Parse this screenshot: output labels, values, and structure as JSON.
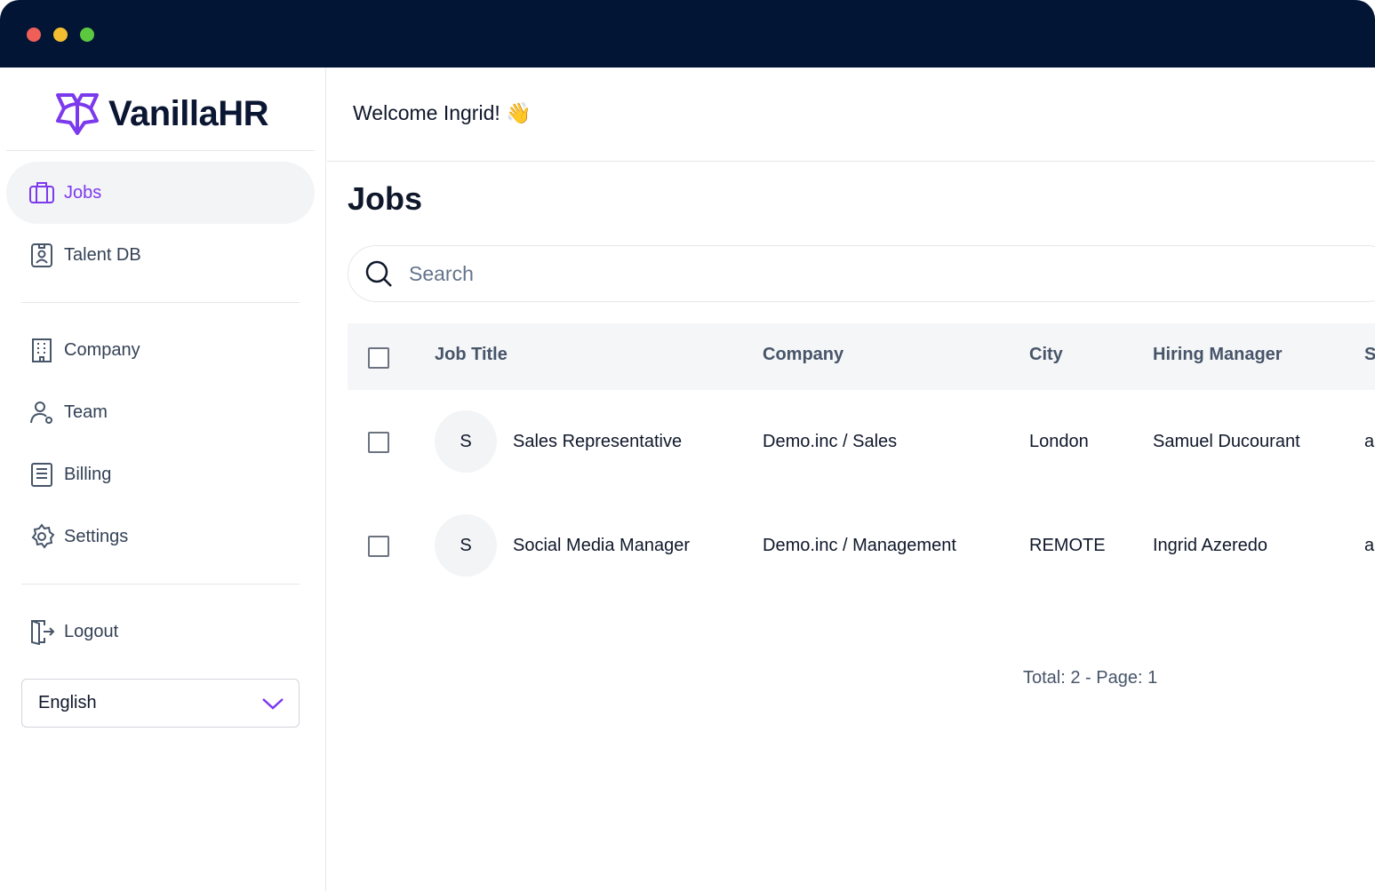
{
  "window": {
    "dots": [
      "#ee5f57",
      "#f5bd30",
      "#5cc840"
    ]
  },
  "brand": {
    "name": "VanillaHR",
    "color": "#7c3aed"
  },
  "sidebar": {
    "items": [
      {
        "label": "Jobs",
        "icon": "briefcase-icon",
        "active": true
      },
      {
        "label": "Talent DB",
        "icon": "id-badge-icon"
      },
      {
        "label": "Company",
        "icon": "building-icon"
      },
      {
        "label": "Team",
        "icon": "user-icon"
      },
      {
        "label": "Billing",
        "icon": "receipt-icon"
      },
      {
        "label": "Settings",
        "icon": "gear-icon"
      },
      {
        "label": "Logout",
        "icon": "logout-icon"
      }
    ],
    "language": "English"
  },
  "header": {
    "welcome": "Welcome Ingrid! 👋"
  },
  "main": {
    "title": "Jobs",
    "search_placeholder": "Search",
    "columns": [
      "Job Title",
      "Company",
      "City",
      "Hiring Manager",
      "S"
    ],
    "rows": [
      {
        "initial": "S",
        "title": "Sales Representative",
        "company": "Demo.inc / Sales",
        "city": "London",
        "manager": "Samuel Ducourant",
        "extra": "a"
      },
      {
        "initial": "S",
        "title": "Social Media Manager",
        "company": "Demo.inc / Management",
        "city": "REMOTE",
        "manager": "Ingrid Azeredo",
        "extra": "a"
      }
    ],
    "footer": "Total: 2 - Page: 1"
  }
}
